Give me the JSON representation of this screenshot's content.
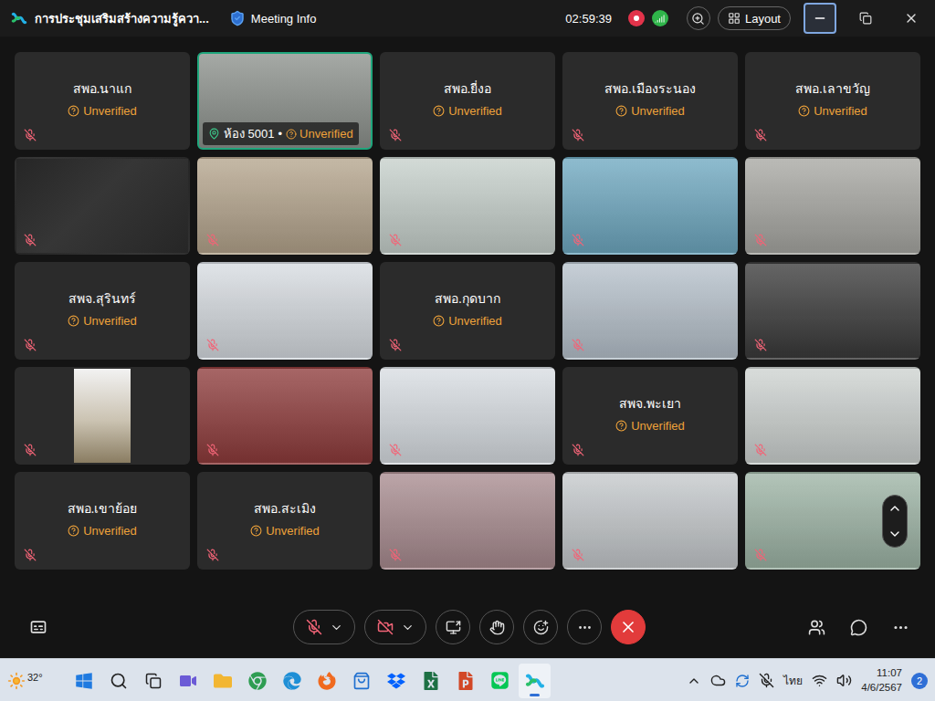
{
  "window": {
    "title": "การประชุมเสริมสร้างความรู้ควา...",
    "meeting_info": "Meeting Info",
    "timer": "02:59:39",
    "layout_button": "Layout"
  },
  "tiles": [
    {
      "kind": "name",
      "name": "สพอ.นาแก",
      "status": "Unverified",
      "muted": true,
      "active": false
    },
    {
      "kind": "video",
      "label": "ห้อง 5001",
      "separator": "•",
      "status": "Unverified",
      "muted": true,
      "active": true,
      "color": "#8c918c"
    },
    {
      "kind": "name",
      "name": "สพอ.ยี่งอ",
      "status": "Unverified",
      "muted": true,
      "active": false
    },
    {
      "kind": "name",
      "name": "สพอ.เมืองระนอง",
      "status": "Unverified",
      "muted": true,
      "active": false
    },
    {
      "kind": "name",
      "name": "สพอ.เลาขวัญ",
      "status": "Unverified",
      "muted": true,
      "active": false
    },
    {
      "kind": "blank",
      "muted": true,
      "active": false
    },
    {
      "kind": "video",
      "muted": true,
      "active": false,
      "color": "#b4a48c"
    },
    {
      "kind": "video",
      "muted": true,
      "active": false,
      "color": "#c6d0cb"
    },
    {
      "kind": "video",
      "muted": true,
      "active": false,
      "color": "#6ea8c0"
    },
    {
      "kind": "video",
      "muted": true,
      "active": false,
      "color": "#a7a7a2"
    },
    {
      "kind": "name",
      "name": "สพจ.สุรินทร์",
      "status": "Unverified",
      "muted": true,
      "active": false
    },
    {
      "kind": "video",
      "muted": true,
      "active": false,
      "color": "#d6dbe0"
    },
    {
      "kind": "name",
      "name": "สพอ.กุดบาก",
      "status": "Unverified",
      "muted": true,
      "active": false
    },
    {
      "kind": "video",
      "muted": true,
      "active": false,
      "color": "#b6c1cb"
    },
    {
      "kind": "video",
      "muted": true,
      "active": false,
      "color": "#3a3a3a"
    },
    {
      "kind": "portrait",
      "muted": true,
      "active": false,
      "color": "#cbc3b2"
    },
    {
      "kind": "video",
      "muted": true,
      "active": false,
      "color": "#8e3b3b"
    },
    {
      "kind": "video",
      "muted": true,
      "active": false,
      "color": "#d8dde2"
    },
    {
      "kind": "name",
      "name": "สพจ.พะเยา",
      "status": "Unverified",
      "muted": true,
      "active": false
    },
    {
      "kind": "video",
      "muted": true,
      "active": false,
      "color": "#cdd2d0"
    },
    {
      "kind": "name",
      "name": "สพอ.เขาย้อย",
      "status": "Unverified",
      "muted": true,
      "active": false
    },
    {
      "kind": "name",
      "name": "สพอ.สะเมิง",
      "status": "Unverified",
      "muted": true,
      "active": false
    },
    {
      "kind": "video",
      "muted": true,
      "active": false,
      "color": "#a88b8f"
    },
    {
      "kind": "video",
      "muted": true,
      "active": false,
      "color": "#c4c8cb"
    },
    {
      "kind": "video",
      "muted": true,
      "active": false,
      "color": "#9db4a5"
    }
  ],
  "controls": {
    "mic_muted": true,
    "camera_off": true
  },
  "taskbar": {
    "weather": "32°",
    "apps": [
      {
        "kind": "start",
        "selected": false
      },
      {
        "kind": "search",
        "selected": false
      },
      {
        "kind": "taskview",
        "selected": false
      },
      {
        "kind": "chat",
        "selected": false
      },
      {
        "kind": "explorer",
        "selected": false
      },
      {
        "kind": "chrome",
        "selected": false
      },
      {
        "kind": "edge",
        "selected": false
      },
      {
        "kind": "firefox",
        "selected": false
      },
      {
        "kind": "store",
        "selected": false
      },
      {
        "kind": "dropbox",
        "selected": false
      },
      {
        "kind": "excel",
        "selected": false
      },
      {
        "kind": "powerpoint",
        "selected": false
      },
      {
        "kind": "line",
        "selected": false
      },
      {
        "kind": "webex",
        "selected": true
      }
    ],
    "tray_mic_muted": true,
    "language": "ไทย",
    "time": "11:07",
    "date": "4/6/2567",
    "notifications": "2"
  }
}
